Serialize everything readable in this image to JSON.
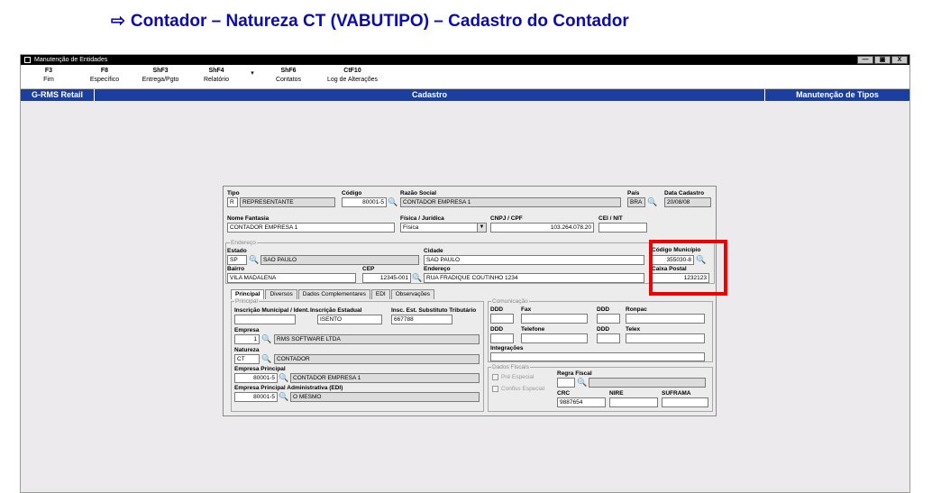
{
  "heading": {
    "arrow": "⇨",
    "text": "Contador – Natureza CT (VABUTIPO) – Cadastro do Contador"
  },
  "window": {
    "title": "Manutenção de Entidades",
    "buttons": [
      "—",
      "▣",
      "X"
    ]
  },
  "toolbar": [
    {
      "key": "F3",
      "label": "Fim"
    },
    {
      "key": "F8",
      "label": "Específico"
    },
    {
      "key": "ShF3",
      "label": "Entrega/Pgto"
    },
    {
      "key": "ShF4",
      "label": "Relatório"
    },
    {
      "key": "ShF6",
      "label": "Contatos"
    },
    {
      "key": "CtF10",
      "label": "Log de Alterações"
    }
  ],
  "toolbar_dropdown": "▾",
  "bar": {
    "left": "G-RMS Retail",
    "center": "Cadastro",
    "right": "Manutenção de Tipos"
  },
  "form": {
    "tipo": {
      "label": "Tipo",
      "code": "R",
      "desc": "REPRESENTANTE"
    },
    "codigo": {
      "label": "Código",
      "value": "80001-5"
    },
    "razao": {
      "label": "Razão Social",
      "value": "CONTADOR EMPRESA 1"
    },
    "pais": {
      "label": "País",
      "value": "BRA"
    },
    "data_cadastro": {
      "label": "Data Cadastro",
      "value": "20/08/08"
    },
    "nome_fantasia": {
      "label": "Nome Fantasia",
      "value": "CONTADOR EMPRESA 1"
    },
    "fisica_juridica": {
      "label": "Física / Jurídica",
      "value": "Física"
    },
    "cnpj": {
      "label": "CNPJ / CPF",
      "value": "103.264.078.20"
    },
    "cei": {
      "label": "CEI / NIT",
      "value": ""
    },
    "endereco_group": "Endereço",
    "estado": {
      "label": "Estado",
      "code": "SP",
      "desc": "SAO PAULO"
    },
    "cidade": {
      "label": "Cidade",
      "value": "SAO PAULO"
    },
    "cod_municipio": {
      "label": "Código Município",
      "value": "355030-8"
    },
    "bairro": {
      "label": "Bairro",
      "value": "VILA MADALENA"
    },
    "cep": {
      "label": "CEP",
      "value": "12345-001"
    },
    "endereco": {
      "label": "Endereço",
      "value": "RUA FRADIQUE COUTINHO 1234"
    },
    "caixa_postal": {
      "label": "Caixa Postal",
      "value": "1232123"
    },
    "tabs": [
      "Principal",
      "Diversos",
      "Dados Complementares",
      "EDI",
      "Observações"
    ],
    "principal": {
      "group": "Principal",
      "insc_municipal": {
        "label": "Inscrição Municipal / Ident.",
        "value": ""
      },
      "insc_estadual": {
        "label": "Inscrição Estadual",
        "value": "ISENTO"
      },
      "insc_subst": {
        "label": "Insc. Est. Substituto Tributário",
        "value": "667788"
      },
      "empresa": {
        "label": "Empresa",
        "code": "1",
        "desc": "RMS SOFTWARE LTDA"
      },
      "natureza": {
        "label": "Natureza",
        "code": "CT",
        "desc": "CONTADOR"
      },
      "empresa_principal": {
        "label": "Empresa Principal",
        "code": "80001-5",
        "desc": "CONTADOR EMPRESA 1"
      },
      "empresa_principal_adm": {
        "label": "Empresa Principal Administrativa (EDI)",
        "code": "80001-5",
        "desc": "O MESMO"
      }
    },
    "comunicacao": {
      "group": "Comunicação",
      "ddd1": "DDD",
      "fax": "Fax",
      "ddd2": "DDD",
      "ramal": "Ronpac",
      "ddd3": "DDD",
      "telefone": "Telefone",
      "ddd4": "DDD",
      "telex": "Telex",
      "integracoes": "Integrações"
    },
    "fiscais": {
      "group": "Dados Fiscais",
      "pre_especial": "Pré Especial",
      "confiss_especial": "Confiss Especial",
      "regra_fiscal": "Regra Fiscal",
      "crc": {
        "label": "CRC",
        "value": "9887654"
      },
      "nire": {
        "label": "NIRE",
        "value": ""
      },
      "suframa": {
        "label": "SUFRAMA",
        "value": ""
      }
    }
  },
  "binoc": "🔍",
  "colors": {
    "title_bar": "#000000",
    "blue_bar": "#1a3fa0",
    "heading": "#0b0bb0",
    "highlight": "#ee0000"
  }
}
